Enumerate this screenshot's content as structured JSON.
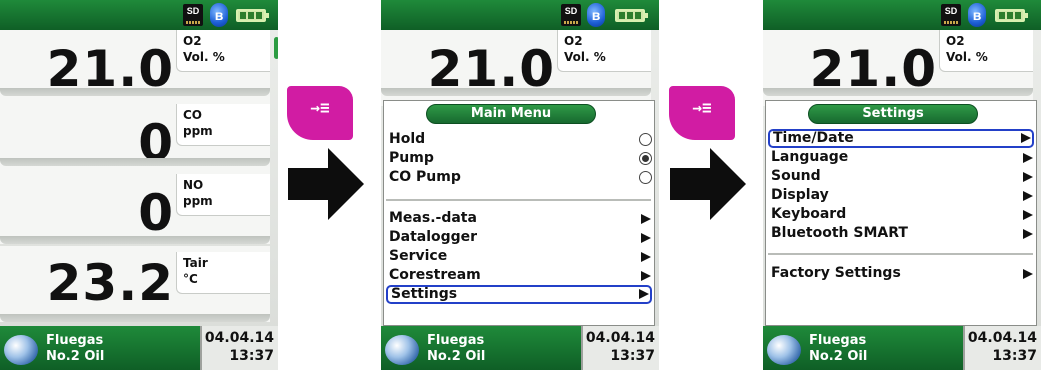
{
  "status_icons": {
    "sd_label": "SD",
    "bluetooth_label": "ʙ"
  },
  "screen1": {
    "readings": [
      {
        "value": "21.0",
        "unit_line1": "O2",
        "unit_line2": "Vol. %"
      },
      {
        "value": "0",
        "unit_line1": "CO",
        "unit_line2": "ppm"
      },
      {
        "value": "0",
        "unit_line1": "NO",
        "unit_line2": "ppm"
      },
      {
        "value": "23.2",
        "unit_line1": "Tair",
        "unit_line2": "°C"
      }
    ]
  },
  "screen2": {
    "reading": {
      "value": "21.0",
      "unit_line1": "O2",
      "unit_line2": "Vol. %"
    },
    "menu_title": "Main Menu",
    "radio_items": [
      {
        "label": "Hold",
        "selected": false
      },
      {
        "label": "Pump",
        "selected": true
      },
      {
        "label": "CO Pump",
        "selected": false
      }
    ],
    "submenu_items": [
      "Meas.-data",
      "Datalogger",
      "Service",
      "Corestream",
      "Settings"
    ],
    "highlighted_item": "Settings"
  },
  "screen3": {
    "reading": {
      "value": "21.0",
      "unit_line1": "O2",
      "unit_line2": "Vol. %"
    },
    "menu_title": "Settings",
    "items": [
      "Time/Date",
      "Language",
      "Sound",
      "Display",
      "Keyboard",
      "Bluetooth SMART"
    ],
    "bottom_item": "Factory Settings",
    "highlighted_item": "Time/Date"
  },
  "footer": {
    "fuel_line1": "Fluegas",
    "fuel_line2": "No.2 Oil",
    "date": "04.04.14",
    "time": "13:37"
  },
  "key_button_label": "→≡",
  "colors": {
    "header_green": "#1f8a3a",
    "key_magenta": "#d11ca3",
    "selection_blue": "#2340c8"
  }
}
